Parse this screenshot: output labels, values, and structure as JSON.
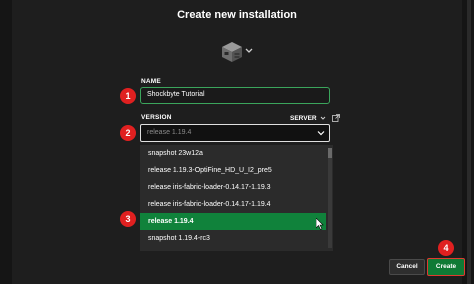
{
  "dialog": {
    "title": "Create new installation"
  },
  "icon_picker": {
    "icon": "furnace-block-icon",
    "caret": "chevron-down-icon"
  },
  "name_field": {
    "label": "NAME",
    "value": "Shockbyte Tutorial"
  },
  "version_field": {
    "label": "VERSION",
    "server_label": "SERVER",
    "value": "release 1.19.4"
  },
  "version_options": [
    {
      "label": "snapshot 23w12a"
    },
    {
      "label": "release 1.19.3-OptiFine_HD_U_I2_pre5"
    },
    {
      "label": "release iris-fabric-loader-0.14.17-1.19.3"
    },
    {
      "label": "release iris-fabric-loader-0.14.17-1.19.4"
    },
    {
      "label": "release 1.19.4"
    },
    {
      "label": "snapshot 1.19.4-rc3"
    }
  ],
  "selected_index": 4,
  "steps": {
    "one": "1",
    "two": "2",
    "three": "3",
    "four": "4"
  },
  "actions": {
    "cancel": "Cancel",
    "create": "Create"
  },
  "colors": {
    "background": "#1e1e1e",
    "accent_green": "#10823b",
    "step_badge_red": "#e02020",
    "input_focus_green": "#3ba55c"
  }
}
